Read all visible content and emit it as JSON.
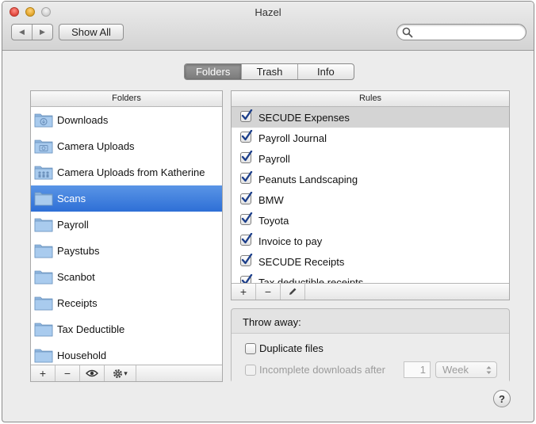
{
  "window": {
    "title": "Hazel",
    "back_glyph": "◀",
    "forward_glyph": "▶",
    "show_all_label": "Show All",
    "search": {
      "value": "",
      "placeholder": ""
    }
  },
  "tabs": [
    {
      "label": "Folders",
      "active": true
    },
    {
      "label": "Trash",
      "active": false
    },
    {
      "label": "Info",
      "active": false
    }
  ],
  "folders_panel": {
    "header": "Folders",
    "items": [
      {
        "label": "Downloads",
        "icon": "downloads-folder-icon",
        "selected": false
      },
      {
        "label": "Camera Uploads",
        "icon": "camera-folder-icon",
        "selected": false
      },
      {
        "label": "Camera Uploads from Katherine",
        "icon": "shared-folder-icon",
        "selected": false
      },
      {
        "label": "Scans",
        "icon": "folder-icon",
        "selected": true
      },
      {
        "label": "Payroll",
        "icon": "folder-icon",
        "selected": false
      },
      {
        "label": "Paystubs",
        "icon": "folder-icon",
        "selected": false
      },
      {
        "label": "Scanbot",
        "icon": "folder-icon",
        "selected": false
      },
      {
        "label": "Receipts",
        "icon": "folder-icon",
        "selected": false
      },
      {
        "label": "Tax Deductible",
        "icon": "folder-icon",
        "selected": false
      },
      {
        "label": "Household",
        "icon": "folder-icon",
        "selected": false
      }
    ],
    "toolbar": {
      "add": "+",
      "remove": "−",
      "gear_caret": "▾"
    }
  },
  "rules_panel": {
    "header": "Rules",
    "items": [
      {
        "label": "SECUDE Expenses",
        "checked": true,
        "selected": true
      },
      {
        "label": "Payroll Journal",
        "checked": true,
        "selected": false
      },
      {
        "label": "Payroll",
        "checked": true,
        "selected": false
      },
      {
        "label": "Peanuts Landscaping",
        "checked": true,
        "selected": false
      },
      {
        "label": "BMW",
        "checked": true,
        "selected": false
      },
      {
        "label": "Toyota",
        "checked": true,
        "selected": false
      },
      {
        "label": "Invoice to pay",
        "checked": true,
        "selected": false
      },
      {
        "label": "SECUDE Receipts",
        "checked": true,
        "selected": false
      },
      {
        "label": "Tax deductible receipts",
        "checked": true,
        "selected": false
      }
    ],
    "toolbar": {
      "add": "+",
      "remove": "−"
    }
  },
  "throw_away": {
    "title": "Throw away:",
    "duplicate_files": {
      "label": "Duplicate files",
      "checked": false
    },
    "incomplete_downloads": {
      "label": "Incomplete downloads after",
      "checked": false,
      "enabled": false
    },
    "incomplete_after_value": "1",
    "incomplete_after_unit": "Week"
  },
  "help_label": "?",
  "colors": {
    "selection_blue": "#3f80dc",
    "rule_selection_gray": "#d4d4d4",
    "checkbox_check": "#1d3f8a",
    "folder_blue": "#9fc5ec"
  }
}
